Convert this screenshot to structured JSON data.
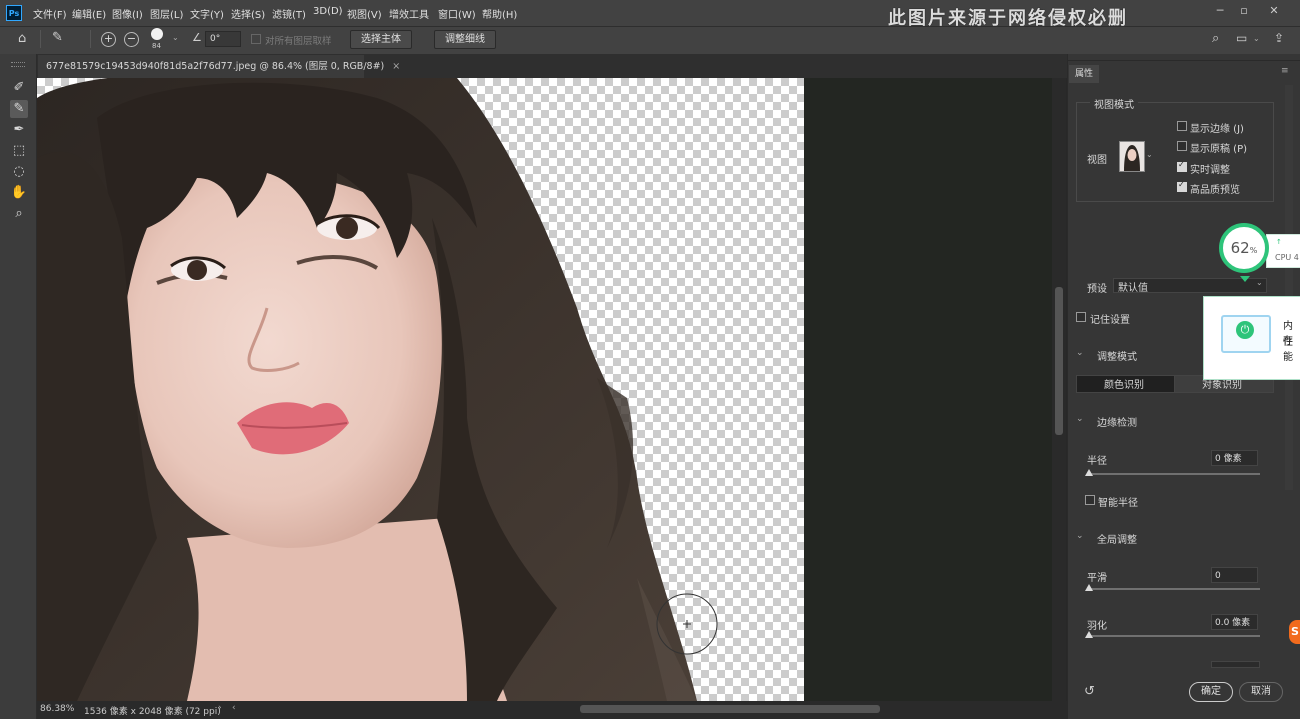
{
  "app": {
    "logo": "Ps"
  },
  "menu": [
    "文件(F)",
    "编辑(E)",
    "图像(I)",
    "图层(L)",
    "文字(Y)",
    "选择(S)",
    "滤镜(T)",
    "3D(D)",
    "视图(V)",
    "增效工具",
    "窗口(W)",
    "帮助(H)"
  ],
  "watermark": "此图片来源于网络侵权必删",
  "options": {
    "brush_size": "84",
    "angle": "0°",
    "sample_all_layers": "对所有图层取样",
    "select_subject": "选择主体",
    "refine_hair": "调整细线"
  },
  "document": {
    "tab_title": "677e81579c19453d940f81d5a2f76d77.jpeg @ 86.4% (图层 0, RGB/8#)",
    "close": "×",
    "zoom": "86.38%",
    "dimensions": "1536 像素 x 2048 像素 (72 ppi)"
  },
  "panel": {
    "tab": "属性",
    "view_mode_title": "视图模式",
    "view_label": "视图",
    "show_edge": "显示边缘 (J)",
    "show_original": "显示原稿 (P)",
    "realtime": "实时调整",
    "hq_preview": "高品质预览",
    "preset_label": "预设",
    "preset_value": "默认值",
    "remember": "记住设置",
    "adjust_mode": "调整模式",
    "color_aware": "颜色识别",
    "object_aware": "对象识别",
    "edge_detection": "边缘检测",
    "radius_label": "半径",
    "radius_value": "0 像素",
    "smart_radius": "智能半径",
    "global": "全局调整",
    "smooth_label": "平滑",
    "smooth_value": "0",
    "feather_label": "羽化",
    "feather_value": "0.0 像素",
    "ok": "确定",
    "cancel": "取消"
  },
  "widget": {
    "cpu_percent": "62",
    "percent_sign": "%",
    "cpu_text": "CPU 4",
    "mem_text1": "内存",
    "mem_text2": "性能"
  },
  "checkbox_states": {
    "show_edge": false,
    "show_original": false,
    "realtime": true,
    "hq_preview": true,
    "remember": false,
    "smart_radius": false
  },
  "colors": {
    "accent_green": "#2ec47a",
    "ps_blue": "#31a8ff"
  }
}
